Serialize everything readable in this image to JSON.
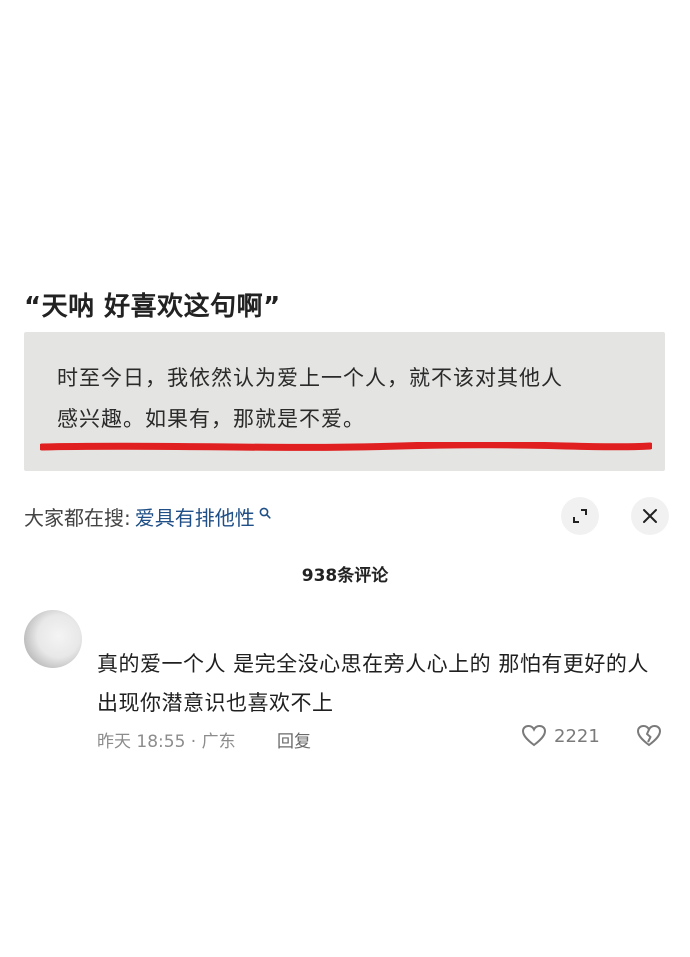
{
  "post": {
    "title": "“天呐 好喜欢这句啊”",
    "quote_line1": "时至今日，我依然认为爱上一个人，就不该对其他人",
    "quote_line2": "感兴趣。如果有，那就是不爱。"
  },
  "search_bar": {
    "prefix": "大家都在搜:",
    "term": "爱具有排他性"
  },
  "comments": {
    "count_label": "938条评论",
    "first": {
      "text": "真的爱一个人 是完全没心思在旁人心上的 那怕有更好的人出现你潜意识也喜欢不上",
      "meta": "昨天 18:55 · 广东",
      "reply_label": "回复",
      "like_count": "2221"
    }
  },
  "colors": {
    "search_term": "#1f4f86",
    "underline": "#e02020",
    "quote_bg": "#e4e4e2"
  }
}
